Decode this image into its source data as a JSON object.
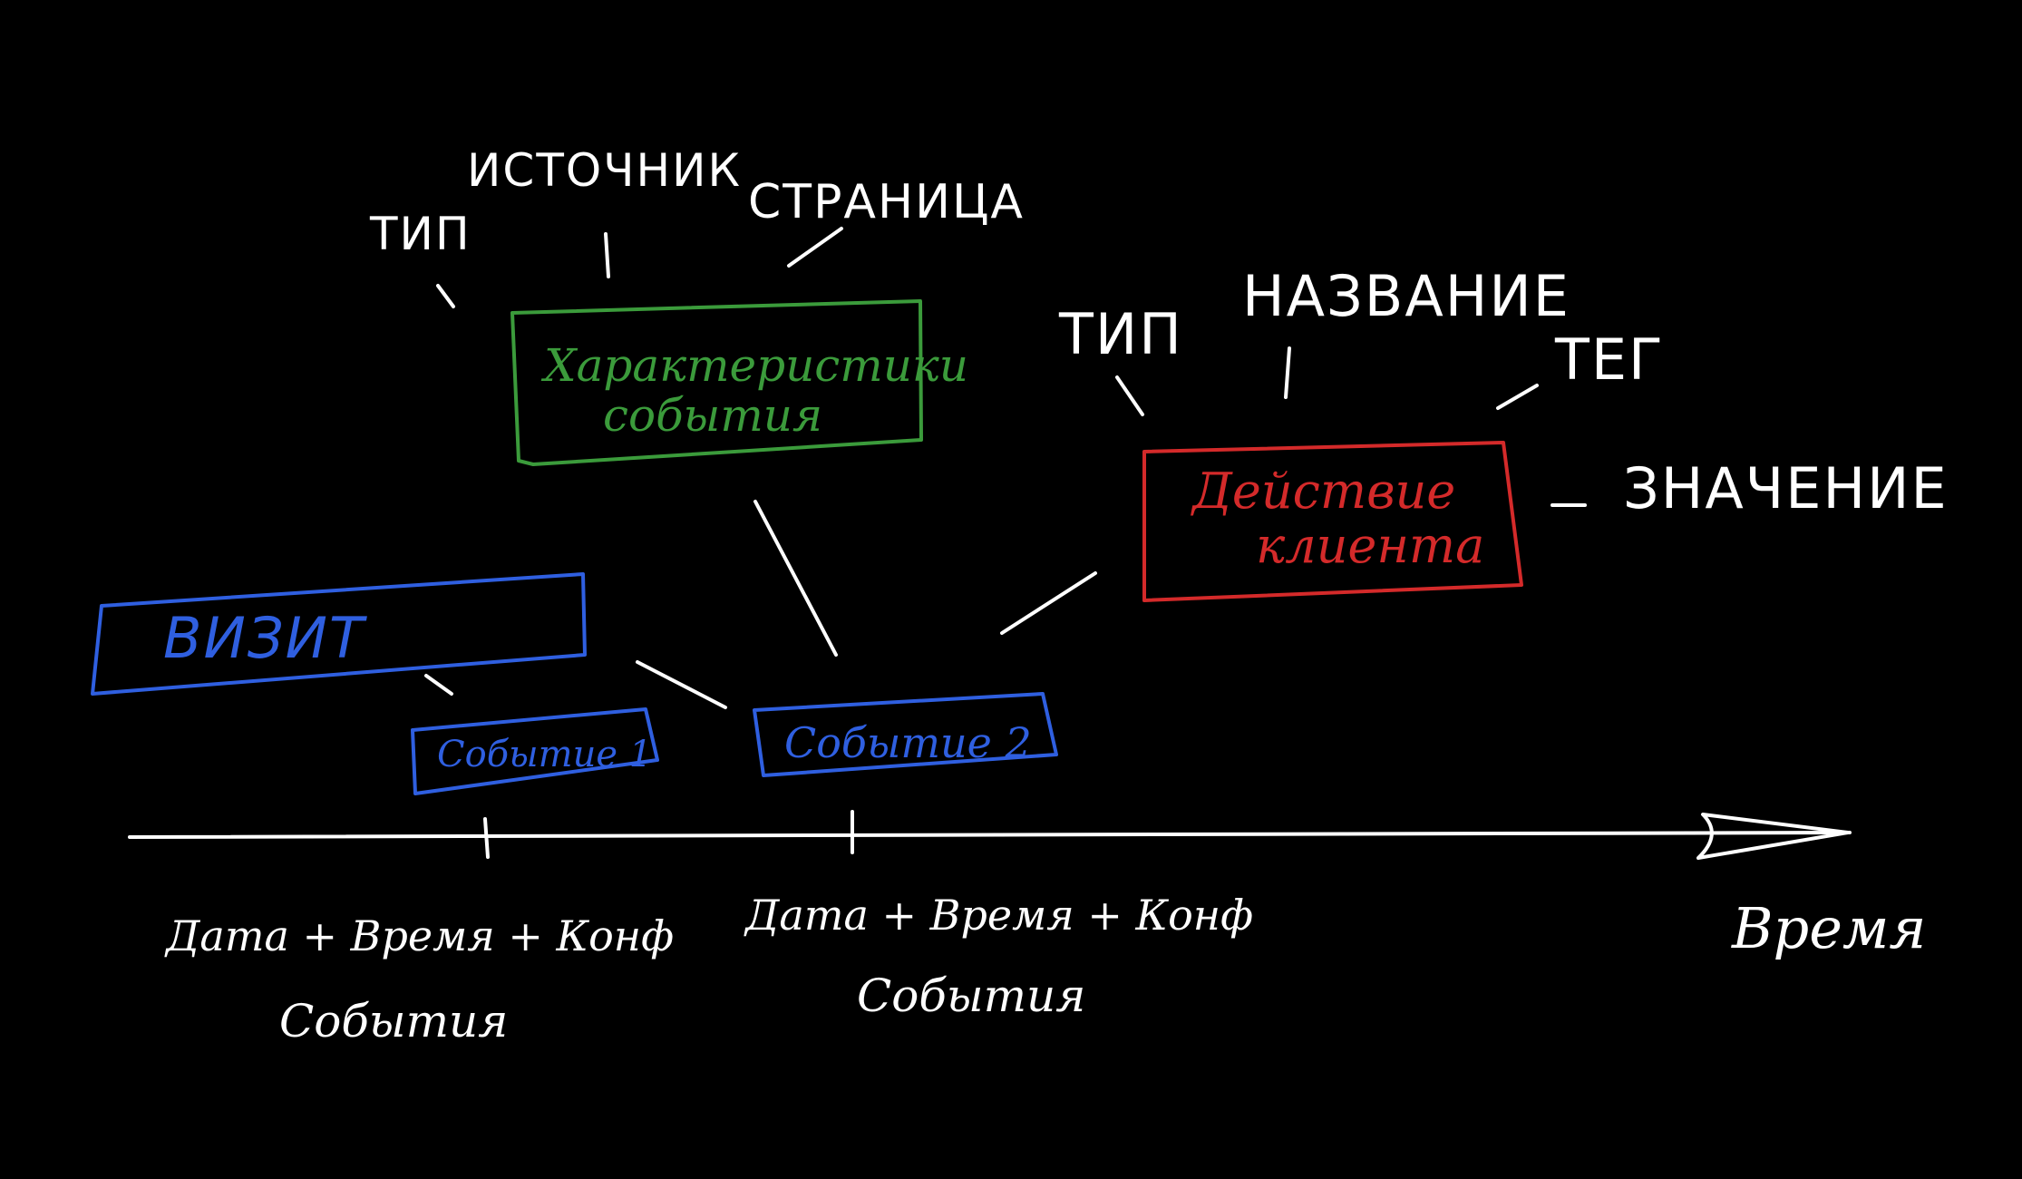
{
  "colors": {
    "background": "#000000",
    "chalk": "#ffffff",
    "green": "#3b9b3b",
    "blue": "#2f5fe0",
    "red": "#d42a2a"
  },
  "boxes": {
    "characteristics_line1": "Характеристики",
    "characteristics_line2": "события",
    "client_action_line1": "Действие",
    "client_action_line2": "клиента",
    "visit": "ВИЗИТ",
    "event1": "Событие 1",
    "event2": "Событие 2"
  },
  "attributes": {
    "type_left": "ТИП",
    "source": "ИСТОЧНИК",
    "page": "СТРАНИЦА",
    "type_right": "ТИП",
    "name": "НАЗВАНИЕ",
    "tag": "ТЕГ",
    "value": "ЗНАЧЕНИЕ"
  },
  "timeline": {
    "axis_label": "Время",
    "tick1_line1": "Дата + Время + Конф",
    "tick1_line2": "События",
    "tick2_line1": "Дата + Время + Конф",
    "tick2_line2": "События"
  }
}
